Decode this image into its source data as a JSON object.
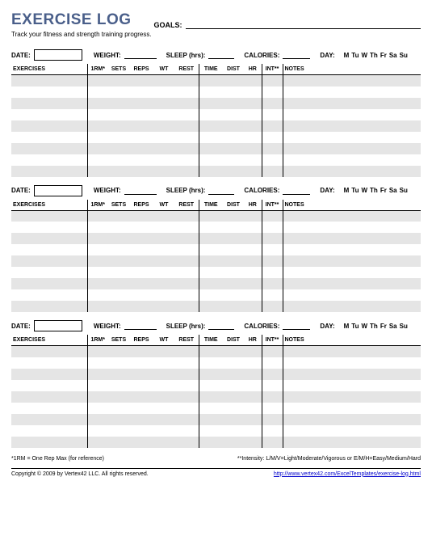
{
  "title": "EXERCISE LOG",
  "subtitle": "Track your fitness and strength training progress.",
  "goals_label": "GOALS:",
  "meta": {
    "date": "DATE:",
    "weight": "WEIGHT:",
    "sleep": "SLEEP (hrs):",
    "calories": "CALORIES:",
    "day": "DAY:",
    "days": [
      "M",
      "Tu",
      "W",
      "Th",
      "Fr",
      "Sa",
      "Su"
    ]
  },
  "columns": {
    "exercises": "EXERCISES",
    "rm": "1RM*",
    "sets": "SETS",
    "reps": "REPS",
    "wt": "WT",
    "rest": "REST",
    "time": "TIME",
    "dist": "DIST",
    "hr": "HR",
    "int": "INT**",
    "notes": "NOTES"
  },
  "footnotes": {
    "left": "*1RM = One Rep Max (for reference)",
    "right": "**Intensity: L/M/V=Light/Moderate/Vigorous or E/M/H=Easy/Medium/Hard"
  },
  "footer": {
    "copyright": "Copyright © 2009 by Vertex42 LLC. All rights reserved.",
    "url": "http://www.vertex42.com/ExcelTemplates/exercise-log.html"
  },
  "blocks": 3,
  "rows_per_block": 9
}
